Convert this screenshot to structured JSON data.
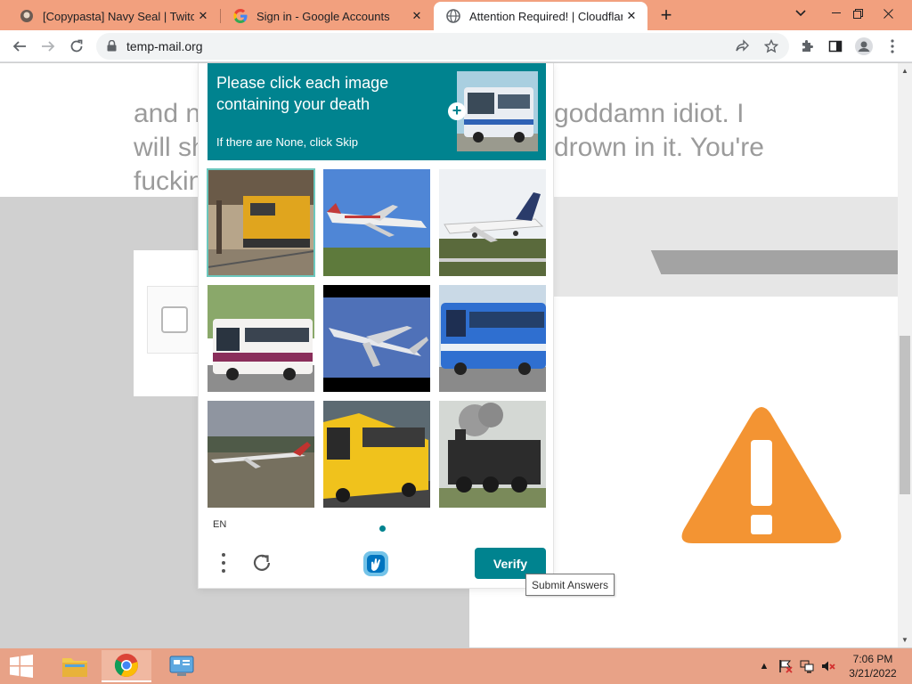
{
  "browser": {
    "tabs": [
      {
        "title": "[Copypasta] Navy Seal | TwitchQu",
        "favicon": "twitchquotes-icon",
        "active": false
      },
      {
        "title": "Sign in - Google Accounts",
        "favicon": "google-icon",
        "active": false
      },
      {
        "title": "Attention Required! | Cloudflare",
        "favicon": "globe-icon",
        "active": true
      }
    ],
    "new_tab_label": "+",
    "url": "temp-mail.org"
  },
  "page": {
    "background_lines": [
      "and n",
      "goddamn idiot. I",
      "will sh",
      "drown in it. You're",
      "fuckin"
    ]
  },
  "captcha": {
    "prompt_title": "Please click each image containing your death",
    "prompt_sub": "If there are None, click Skip",
    "prompt_image": "bus",
    "tiles": [
      {
        "subject": "train",
        "selected": true
      },
      {
        "subject": "airplane",
        "selected": false
      },
      {
        "subject": "airplane",
        "selected": false
      },
      {
        "subject": "bus",
        "selected": false
      },
      {
        "subject": "airplane",
        "selected": false
      },
      {
        "subject": "bus",
        "selected": false
      },
      {
        "subject": "airplane",
        "selected": false
      },
      {
        "subject": "bus",
        "selected": false
      },
      {
        "subject": "train",
        "selected": false
      }
    ],
    "language": "EN",
    "verify_label": "Verify",
    "tooltip": "Submit Answers",
    "accent_color": "#00838f"
  },
  "taskbar": {
    "time": "7:06 PM",
    "date": "3/21/2022"
  },
  "colors": {
    "titlebar": "#f2a07e",
    "warning_orange": "#f39433"
  }
}
